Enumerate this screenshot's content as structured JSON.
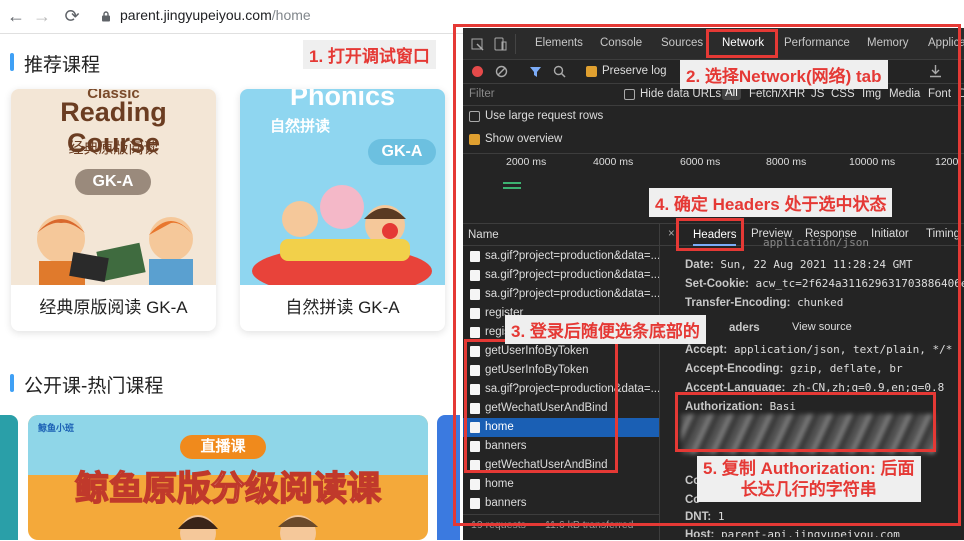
{
  "browser": {
    "url_host": "parent.jingyupeiyou.com",
    "url_path": "/home",
    "back": "←",
    "forward": "→",
    "reload": "⟳"
  },
  "page": {
    "section1_title": "推荐课程",
    "cards": [
      {
        "banner": "Reading Course",
        "banner_top": "Classic",
        "subtitle": "经典原版阅读",
        "level": "GK-A",
        "caption": "经典原版阅读 GK-A"
      },
      {
        "banner": "Phonics",
        "subtitle": "自然拼读",
        "level": "GK-A",
        "caption": "自然拼读 GK-A"
      }
    ],
    "section2_title": "公开课-热门课程",
    "live_badge": "直播课",
    "live_banner": "鲸鱼原版分级阅读课",
    "brand": "鲸鱼小班"
  },
  "devtools": {
    "tabs": [
      "Elements",
      "Console",
      "Sources",
      "Network",
      "Performance",
      "Memory",
      "Applica"
    ],
    "active_tab": "Network",
    "preserve_log": "Preserve log",
    "filter_placeholder": "Filter",
    "hide_data_urls": "Hide data URLs",
    "filter_types": [
      "All",
      "Fetch/XHR",
      "JS",
      "CSS",
      "Img",
      "Media",
      "Font",
      "D"
    ],
    "large_rows": "Use large request rows",
    "show_overview": "Show overview",
    "timeline_ticks": [
      "2000 ms",
      "4000 ms",
      "6000 ms",
      "8000 ms",
      "10000 ms",
      "1200"
    ],
    "name_header": "Name",
    "detail_tabs": [
      "Headers",
      "Preview",
      "Response",
      "Initiator",
      "Timing"
    ],
    "requests": [
      "sa.gif?project=production&data=...",
      "sa.gif?project=production&data=...",
      "sa.gif?project=production&data=...",
      "register",
      "register",
      "getUserInfoByToken",
      "getUserInfoByToken",
      "sa.gif?project=production&data=...",
      "getWechatUserAndBind",
      "home",
      "banners",
      "getWechatUserAndBind",
      "home",
      "banners"
    ],
    "selected_index": 9,
    "status_requests": "19 requests",
    "status_transferred": "11.6 kB transferred",
    "response_headers": [
      {
        "k": "",
        "v": "application/json"
      },
      {
        "k": "Date:",
        "v": "Sun, 22 Aug 2021 11:28:24 GMT"
      },
      {
        "k": "Set-Cookie:",
        "v": "acw_tc=2f624a311629631703886406e"
      },
      {
        "k": "Transfer-Encoding:",
        "v": "chunked"
      }
    ],
    "request_headers_label": "aders",
    "view_source": "View source",
    "request_headers": [
      {
        "k": "Accept:",
        "v": "application/json, text/plain, */*"
      },
      {
        "k": "Accept-Encoding:",
        "v": "gzip, deflate, br"
      },
      {
        "k": "Accept-Language:",
        "v": "zh-CN,zh;q=0.9,en;q=0.8"
      },
      {
        "k": "Authorization:",
        "v": "Basi"
      }
    ],
    "trailing_headers": [
      {
        "k": "Co",
        "v": ""
      },
      {
        "k": "Co",
        "v": ""
      },
      {
        "k": "DNT:",
        "v": "1"
      },
      {
        "k": "Host:",
        "v": "parent-api.jingyupeiyou.com"
      }
    ]
  },
  "annotations": {
    "step1": "1. 打开调试窗口",
    "step2": "2. 选择Network(网络) tab",
    "step3": "3. 登录后随便选条底部的",
    "step4": "4. 确定 Headers 处于选中状态",
    "step5_line1": "5. 复制 Authorization: 后面",
    "step5_line2": "长达几行的字符串"
  },
  "colors": {
    "accent": "#3fa0f5",
    "annotation": "#e53935",
    "selected_row": "#1a5fb4"
  }
}
